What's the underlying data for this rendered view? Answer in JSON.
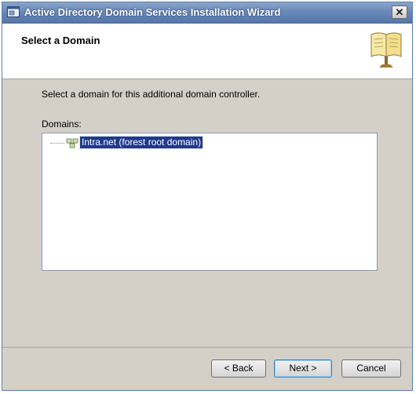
{
  "window": {
    "title": "Active Directory Domain Services Installation Wizard",
    "close_label": "✕"
  },
  "header": {
    "title": "Select a Domain",
    "icon": "book-icon"
  },
  "content": {
    "instruction": "Select a domain for this additional domain controller.",
    "domains_label": "Domains:",
    "tree": [
      {
        "label": "Intra.net (forest root domain)",
        "selected": true,
        "icon": "domain-icon"
      }
    ]
  },
  "footer": {
    "back_label": "< Back",
    "next_label": "Next >",
    "cancel_label": "Cancel"
  },
  "colors": {
    "titlebar": "#6a88b8",
    "selection": "#1f3a8a",
    "dialog_bg": "#d4d0c8"
  }
}
